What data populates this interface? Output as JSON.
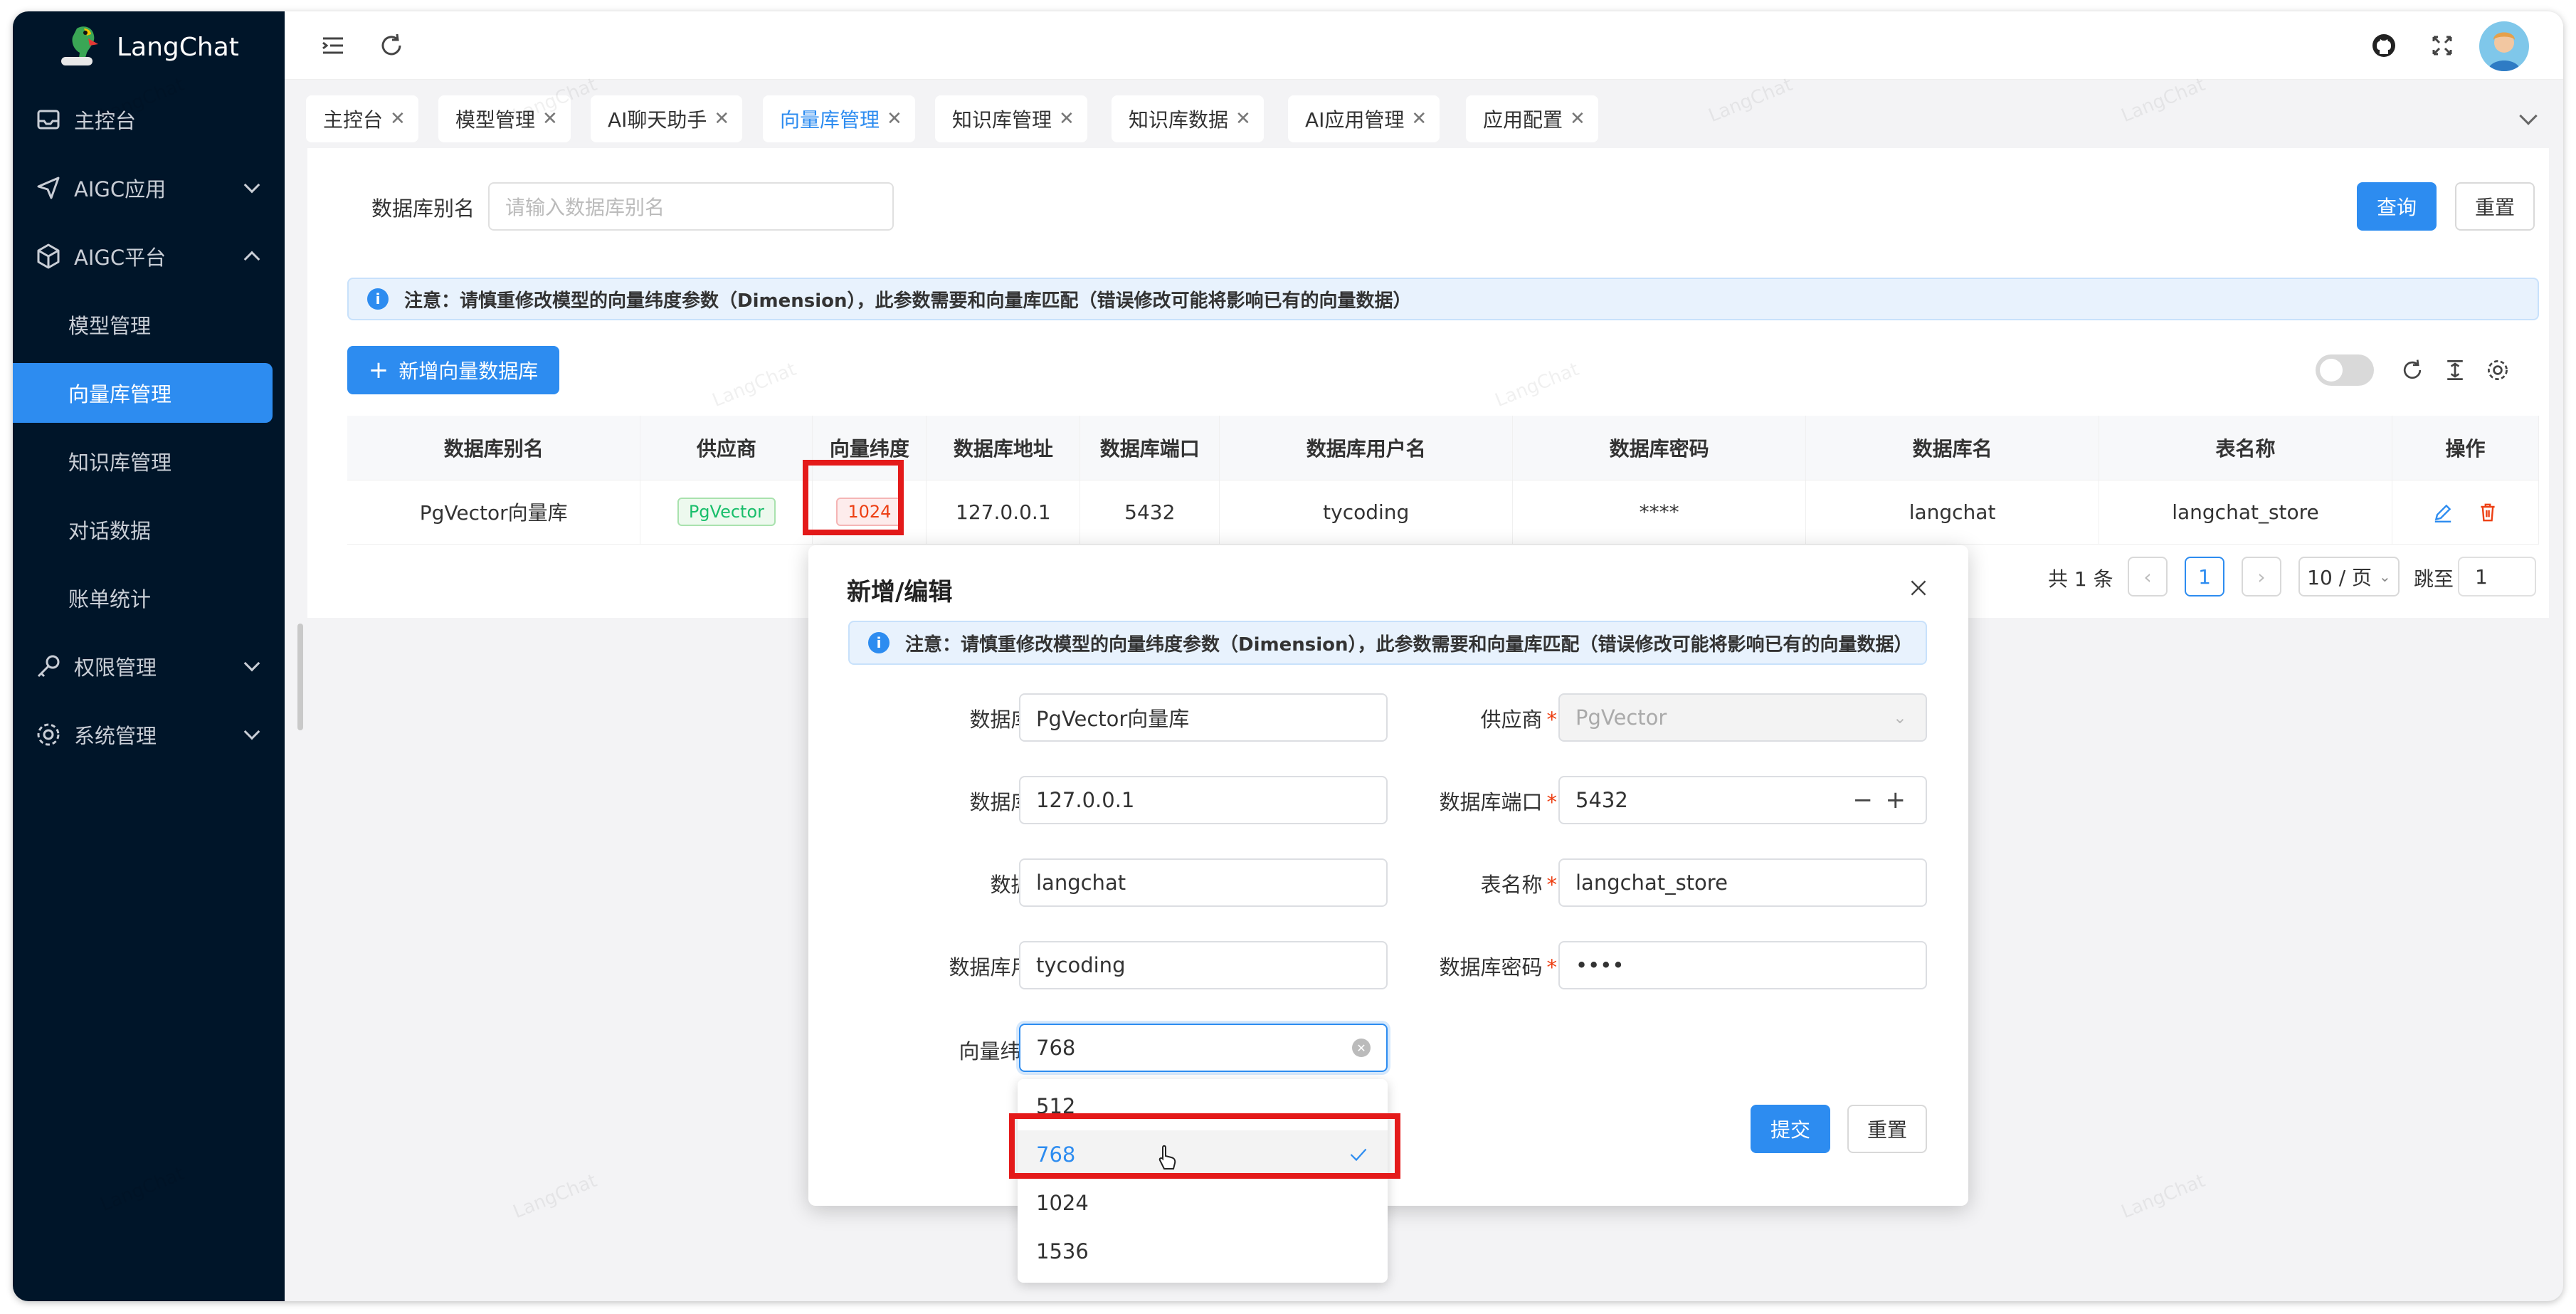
{
  "app": {
    "name": "LangChat"
  },
  "sidebar": {
    "items": [
      {
        "label": "主控台",
        "icon": "dashboard-icon"
      },
      {
        "label": "AIGC应用",
        "icon": "send-icon"
      },
      {
        "label": "AIGC平台",
        "icon": "box-icon"
      },
      {
        "label": "权限管理",
        "icon": "key-icon"
      },
      {
        "label": "系统管理",
        "icon": "gear-icon"
      }
    ],
    "sub_items": [
      "模型管理",
      "向量库管理",
      "知识库管理",
      "对话数据",
      "账单统计"
    ]
  },
  "tabs": [
    "主控台",
    "模型管理",
    "AI聊天助手",
    "向量库管理",
    "知识库管理",
    "知识库数据",
    "AI应用管理",
    "应用配置"
  ],
  "search": {
    "label": "数据库别名",
    "placeholder": "请输入数据库别名",
    "query_label": "查询",
    "reset_label": "重置"
  },
  "notice": "注意：请慎重修改模型的向量纬度参数（Dimension），此参数需要和向量库匹配（错误修改可能将影响已有的向量数据）",
  "add_button": "新增向量数据库",
  "table": {
    "headers": [
      "数据库别名",
      "供应商",
      "向量纬度",
      "数据库地址",
      "数据库端口",
      "数据库用户名",
      "数据库密码",
      "数据库名",
      "表名称",
      "操作"
    ],
    "row": {
      "alias": "PgVector向量库",
      "provider": "PgVector",
      "dimension": "1024",
      "host": "127.0.0.1",
      "port": "5432",
      "username": "tycoding",
      "password": "****",
      "dbname": "langchat",
      "table": "langchat_store"
    }
  },
  "pagination": {
    "total": "共 1 条",
    "page": "1",
    "page_size": "10 / 页",
    "jump_label": "跳至",
    "jump_value": "1"
  },
  "modal": {
    "title": "新增/编辑",
    "notice": "注意：请慎重修改模型的向量纬度参数（Dimension），此参数需要和向量库匹配（错误修改可能将影响已有的向量数据）",
    "fields": {
      "alias": {
        "label": "数据库别名",
        "value": "PgVector向量库"
      },
      "provider": {
        "label": "供应商",
        "value": "PgVector"
      },
      "host": {
        "label": "数据库地址",
        "value": "127.0.0.1"
      },
      "port": {
        "label": "数据库端口",
        "value": "5432"
      },
      "dbname": {
        "label": "数据库名",
        "value": "langchat"
      },
      "table": {
        "label": "表名称",
        "value": "langchat_store"
      },
      "username": {
        "label": "数据库用户名",
        "value": "tycoding"
      },
      "password": {
        "label": "数据库密码",
        "value": "••••"
      },
      "dimension": {
        "label": "向量纬度",
        "value": "768"
      }
    },
    "submit_label": "提交",
    "reset_label": "重置",
    "dimension_options": [
      "512",
      "768",
      "1024",
      "1536"
    ],
    "selected_option": "768"
  },
  "watermark": "LangChat",
  "colors": {
    "primary": "#2d8cf0",
    "sidebar": "#001529",
    "highlight": "#e41a1a"
  }
}
